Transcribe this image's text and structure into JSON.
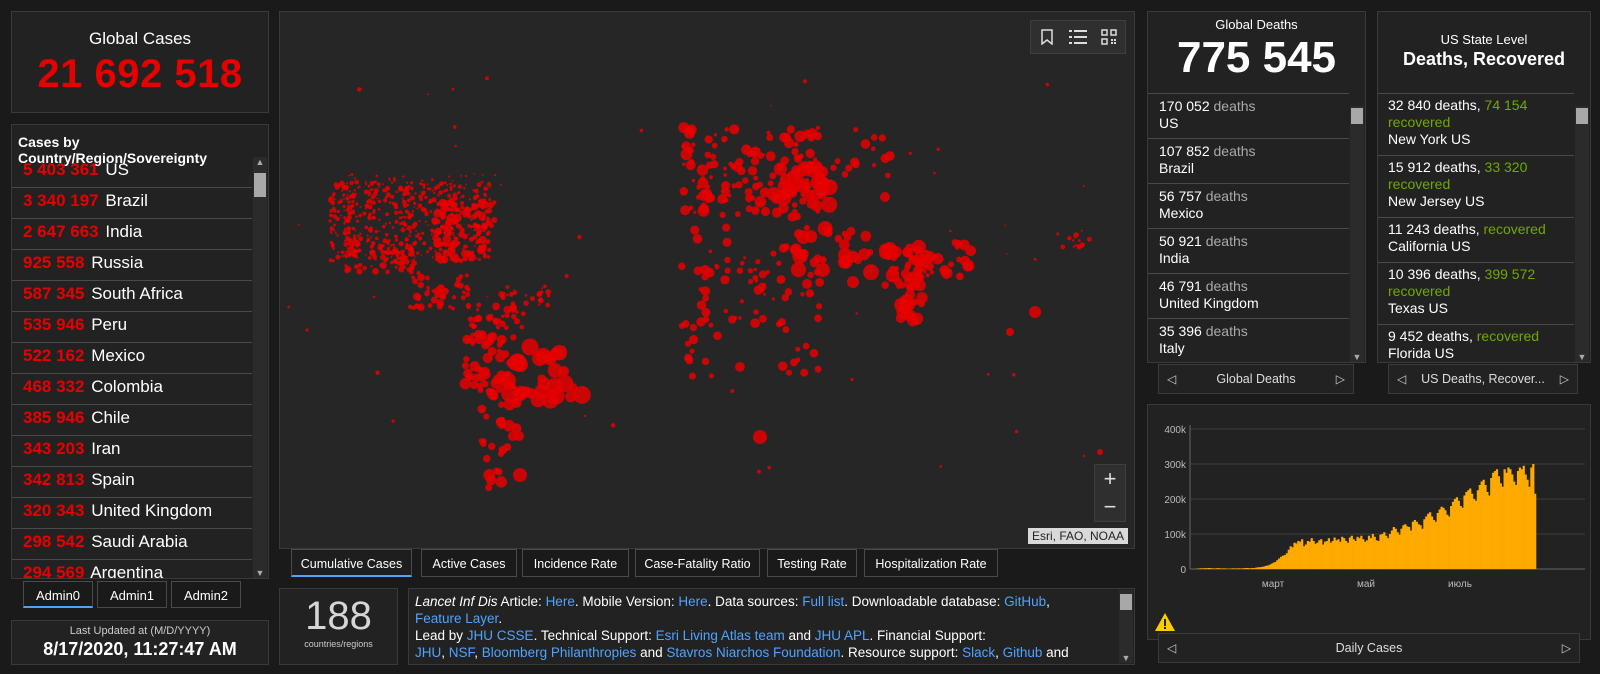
{
  "global_cases": {
    "title": "Global Cases",
    "value": "21 692 518"
  },
  "country_list": {
    "title": "Cases by Country/Region/Sovereignty",
    "items": [
      {
        "num": "5 403 361",
        "name": "US"
      },
      {
        "num": "3 340 197",
        "name": "Brazil"
      },
      {
        "num": "2 647 663",
        "name": "India"
      },
      {
        "num": "925 558",
        "name": "Russia"
      },
      {
        "num": "587 345",
        "name": "South Africa"
      },
      {
        "num": "535 946",
        "name": "Peru"
      },
      {
        "num": "522 162",
        "name": "Mexico"
      },
      {
        "num": "468 332",
        "name": "Colombia"
      },
      {
        "num": "385 946",
        "name": "Chile"
      },
      {
        "num": "343 203",
        "name": "Iran"
      },
      {
        "num": "342 813",
        "name": "Spain"
      },
      {
        "num": "320 343",
        "name": "United Kingdom"
      },
      {
        "num": "298 542",
        "name": "Saudi Arabia"
      },
      {
        "num": "294 569",
        "name": "Argentina"
      }
    ]
  },
  "admin_tabs": [
    "Admin0",
    "Admin1",
    "Admin2"
  ],
  "last_updated": {
    "label": "Last Updated at (M/D/YYYY)",
    "value": "8/17/2020, 11:27:47 AM"
  },
  "map": {
    "attribution": "Esri, FAO, NOAA",
    "zoom_in": "+",
    "zoom_out": "−"
  },
  "map_tabs": [
    "Cumulative Cases",
    "Active Cases",
    "Incidence Rate",
    "Case-Fatality Ratio",
    "Testing Rate",
    "Hospitalization Rate"
  ],
  "countries": {
    "value": "188",
    "label": "countries/regions"
  },
  "info": {
    "t1": "Lancet Inf Dis",
    "t2": " Article: ",
    "l_here1": "Here",
    "t3": ". Mobile Version: ",
    "l_here2": "Here",
    "t4": ". Data sources: ",
    "l_full": "Full list",
    "t5": ". Downloadable database: ",
    "l_github": "GitHub",
    "t6": ", ",
    "l_feature": "Feature Layer",
    "t7": ".",
    "t8": "Lead by ",
    "l_jhucsse": "JHU CSSE",
    "t9": ". Technical Support: ",
    "l_esri": "Esri Living Atlas team",
    "t10": " and ",
    "l_apl": "JHU APL",
    "t11": ". Financial Support:",
    "l_jhu": "JHU",
    "t12": ", ",
    "l_nsf": "NSF",
    "t13": ", ",
    "l_bloomberg": "Bloomberg Philanthropies",
    "t14": " and ",
    "l_stavros": "Stavros Niarchos Foundation",
    "t15": ". Resource support: ",
    "l_slack": "Slack",
    "t16": ", ",
    "l_github2": "Github",
    "t17": " and"
  },
  "global_deaths": {
    "title": "Global Deaths",
    "value": "775 545",
    "unit": "deaths",
    "items": [
      {
        "n": "170 052",
        "place": "US"
      },
      {
        "n": "107 852",
        "place": "Brazil"
      },
      {
        "n": "56 757",
        "place": "Mexico"
      },
      {
        "n": "50 921",
        "place": "India"
      },
      {
        "n": "46 791",
        "place": "United Kingdom"
      },
      {
        "n": "35 396",
        "place": "Italy"
      }
    ],
    "nav_label": "Global Deaths"
  },
  "us_state": {
    "title": "US State Level",
    "subtitle": "Deaths, Recovered",
    "deaths_word": "deaths,",
    "recovered_word": "recovered",
    "items": [
      {
        "deaths": "32 840",
        "recovered": "74 154",
        "place": "New York US"
      },
      {
        "deaths": "15 912",
        "recovered": "33 320",
        "place": "New Jersey US"
      },
      {
        "deaths": "11 243",
        "recovered": "",
        "place": "California US"
      },
      {
        "deaths": "10 396",
        "recovered": "399 572",
        "place": "Texas US"
      },
      {
        "deaths": "9 452",
        "recovered": "",
        "place": "Florida US"
      }
    ],
    "nav_label": "US Deaths, Recover..."
  },
  "daily_nav_label": "Daily Cases",
  "colors": {
    "accent": "#4fa3ff",
    "cases_red": "#e60000",
    "recovered_green": "#70a800",
    "bar_orange": "#ffaa00"
  },
  "chart_data": {
    "type": "bar",
    "x_tick_labels": [
      "март",
      "май",
      "июль"
    ],
    "y_tick_labels": [
      "0",
      "100k",
      "200k",
      "300k",
      "400k"
    ],
    "ylim": [
      0,
      400000
    ],
    "values": [
      1000,
      1500,
      2000,
      1800,
      2500,
      2000,
      3000,
      2500,
      2000,
      1500,
      2000,
      2500,
      1800,
      1500,
      2000,
      1500,
      1000,
      1200,
      1500,
      2000,
      1500,
      1800,
      2000,
      1500,
      2000,
      2500,
      3000,
      2500,
      2000,
      3000,
      2500,
      4000,
      5000,
      5000,
      6000,
      7000,
      9000,
      10000,
      12000,
      15000,
      18000,
      20000,
      25000,
      30000,
      35000,
      38000,
      40000,
      45000,
      55000,
      65000,
      62000,
      75000,
      73000,
      80000,
      78000,
      85000,
      65000,
      70000,
      80000,
      78000,
      88000,
      80000,
      72000,
      75000,
      82000,
      85000,
      70000,
      78000,
      80000,
      88000,
      75000,
      80000,
      90000,
      82000,
      85000,
      78000,
      92000,
      88000,
      80000,
      75000,
      90000,
      95000,
      85000,
      80000,
      92000,
      88000,
      95000,
      85000,
      78000,
      82000,
      95000,
      88000,
      100000,
      92000,
      82000,
      80000,
      98000,
      100000,
      105000,
      95000,
      88000,
      100000,
      110000,
      120000,
      115000,
      105000,
      98000,
      115000,
      125000,
      128000,
      122000,
      120000,
      110000,
      135000,
      140000,
      135000,
      128000,
      125000,
      115000,
      142000,
      150000,
      158000,
      162000,
      150000,
      140000,
      135000,
      160000,
      170000,
      178000,
      175000,
      168000,
      155000,
      150000,
      180000,
      192000,
      200000,
      205000,
      195000,
      180000,
      175000,
      210000,
      220000,
      225000,
      230000,
      215000,
      200000,
      195000,
      225000,
      240000,
      250000,
      255000,
      240000,
      220000,
      210000,
      260000,
      275000,
      280000,
      285000,
      265000,
      245000,
      235000,
      285000,
      275000,
      290000,
      285000,
      270000,
      250000,
      240000,
      280000,
      290000,
      285000,
      295000,
      270000,
      255000,
      235000,
      290000,
      300000,
      215000
    ]
  }
}
